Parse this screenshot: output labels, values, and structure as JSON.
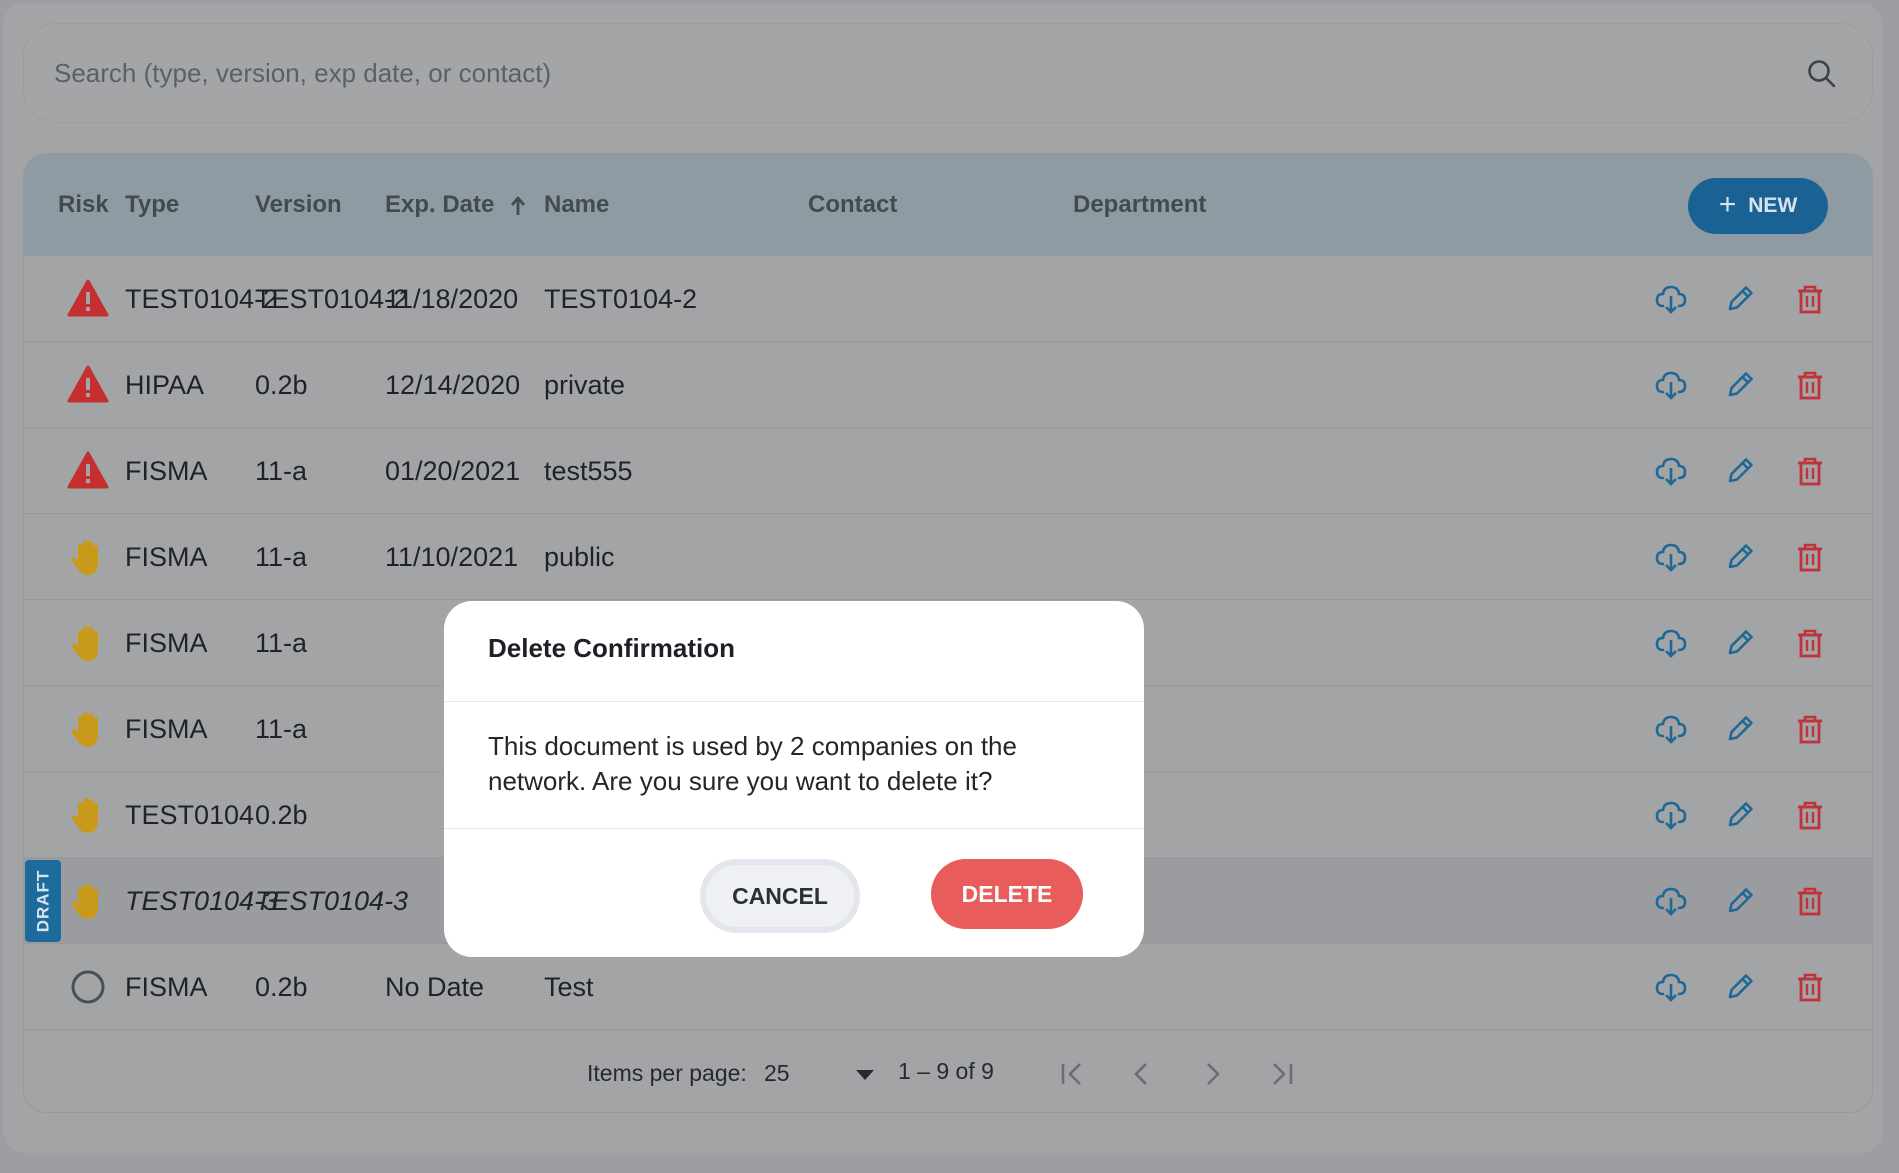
{
  "search": {
    "placeholder": "Search (type, version, exp date, or contact)"
  },
  "table": {
    "columns": {
      "risk": "Risk",
      "type": "Type",
      "version": "Version",
      "exp_date": "Exp. Date",
      "name": "Name",
      "contact": "Contact",
      "department": "Department"
    },
    "new_button": "NEW",
    "rows": [
      {
        "risk": "warning",
        "type": "TEST0104-2",
        "version": "TEST0104-2",
        "exp_date": "11/18/2020",
        "name": "TEST0104-2",
        "contact": "",
        "department": ""
      },
      {
        "risk": "warning",
        "type": "HIPAA",
        "version": "0.2b",
        "exp_date": "12/14/2020",
        "name": "private",
        "contact": "",
        "department": ""
      },
      {
        "risk": "warning",
        "type": "FISMA",
        "version": "11-a",
        "exp_date": "01/20/2021",
        "name": "test555",
        "contact": "",
        "department": ""
      },
      {
        "risk": "caution",
        "type": "FISMA",
        "version": "11-a",
        "exp_date": "11/10/2021",
        "name": "public",
        "contact": "",
        "department": ""
      },
      {
        "risk": "caution",
        "type": "FISMA",
        "version": "11-a",
        "exp_date": "",
        "name": "",
        "contact": "",
        "department": ""
      },
      {
        "risk": "caution",
        "type": "FISMA",
        "version": "11-a",
        "exp_date": "",
        "name": "",
        "contact": "",
        "department": ""
      },
      {
        "risk": "caution",
        "type": "TEST0104",
        "version": "0.2b",
        "exp_date": "",
        "name": "",
        "contact": "",
        "department": ""
      },
      {
        "risk": "caution",
        "type": "TEST0104-3",
        "version": "TEST0104-3",
        "exp_date": "",
        "name": "",
        "contact": "",
        "department": "",
        "draft": true,
        "badge": "DRAFT"
      },
      {
        "risk": "none",
        "type": "FISMA",
        "version": "0.2b",
        "exp_date": "No Date",
        "name": "Test",
        "contact": "",
        "department": ""
      }
    ]
  },
  "pager": {
    "items_per_page_label": "Items per page:",
    "items_per_page": "25",
    "range": "1 – 9 of 9"
  },
  "modal": {
    "title": "Delete Confirmation",
    "message": "This document is used by 2 companies on the network. Are you sure you want to delete it?",
    "cancel_label": "CANCEL",
    "delete_label": "DELETE"
  },
  "colors": {
    "primary": "#1a6293",
    "danger": "#e85c5c",
    "warning": "#c62f2f",
    "caution": "#c99a1a",
    "action_icon": "#1f6896",
    "delete_icon": "#c0333a"
  }
}
